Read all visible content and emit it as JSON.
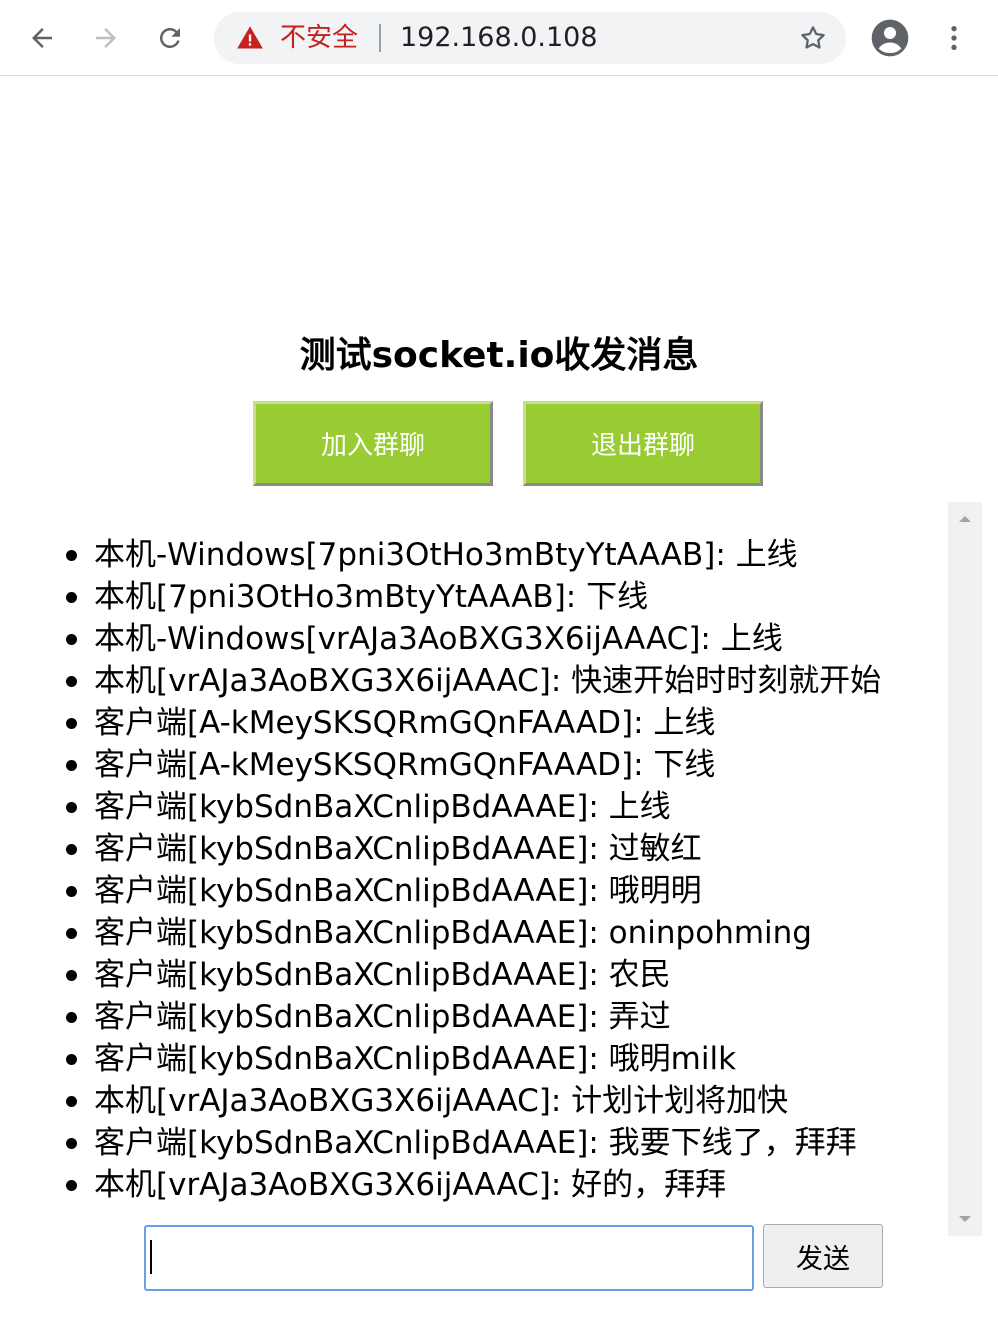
{
  "browser": {
    "security_label": "不安全",
    "url": "192.168.0.108",
    "icons": [
      "back-arrow-icon",
      "forward-arrow-icon",
      "reload-icon",
      "warning-triangle-icon",
      "star-icon",
      "account-circle-icon",
      "more-vert-icon"
    ]
  },
  "page": {
    "title": "测试socket.io收发消息",
    "join_label": "加入群聊",
    "leave_label": "退出群聊",
    "send_label": "发送",
    "input_value": ""
  },
  "messages": [
    "本机-Windows[7pni3OtHo3mBtyYtAAAB]: 上线",
    "本机[7pni3OtHo3mBtyYtAAAB]: 下线",
    "本机-Windows[vrAJa3AoBXG3X6ijAAAC]: 上线",
    "本机[vrAJa3AoBXG3X6ijAAAC]: 快速开始时时刻就开始",
    "客户端[A-kMeySKSQRmGQnFAAAD]: 上线",
    "客户端[A-kMeySKSQRmGQnFAAAD]: 下线",
    "客户端[kybSdnBaXCnlipBdAAAE]: 上线",
    "客户端[kybSdnBaXCnlipBdAAAE]: 过敏红",
    "客户端[kybSdnBaXCnlipBdAAAE]: 哦明明",
    "客户端[kybSdnBaXCnlipBdAAAE]: oninpohming",
    "客户端[kybSdnBaXCnlipBdAAAE]: 农民",
    "客户端[kybSdnBaXCnlipBdAAAE]: 弄过",
    "客户端[kybSdnBaXCnlipBdAAAE]: 哦明milk",
    "本机[vrAJa3AoBXG3X6ijAAAC]: 计划计划将加快",
    "客户端[kybSdnBaXCnlipBdAAAE]: 我要下线了，拜拜",
    "本机[vrAJa3AoBXG3X6ijAAAC]: 好的，拜拜"
  ],
  "colors": {
    "button_green": "#99cc33",
    "insecure_red": "#c5221f",
    "input_focus": "#6c9ee8"
  }
}
